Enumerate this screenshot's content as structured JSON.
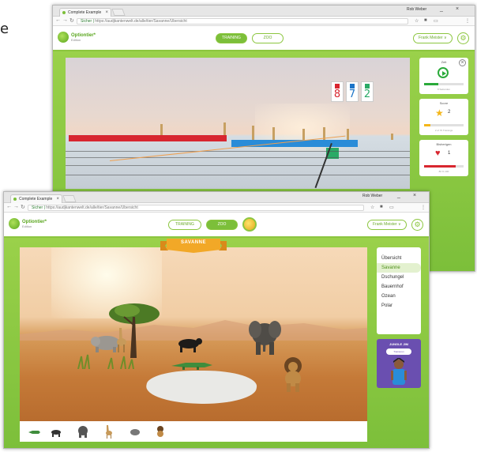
{
  "edge_label": "e",
  "browser": {
    "tab_title": "Complete Example",
    "user": "Rob Weber",
    "url_secure": "Sicher",
    "url_rest": "https://audjkantenwelt.de/alle/tier/Savanne/Ubersicht",
    "controls": [
      "_",
      "□",
      "×"
    ]
  },
  "app": {
    "logo_text": "Optiontier*",
    "logo_sub": "Edition",
    "nav": [
      "TRAINING",
      "ZOO"
    ],
    "user_pill": "Frank Meister ∨"
  },
  "window1": {
    "score": [
      {
        "digit": "8",
        "color": "#d8262f"
      },
      {
        "digit": "7",
        "color": "#1c75c8"
      },
      {
        "digit": "2",
        "color": "#2aaa66"
      }
    ],
    "stats": [
      {
        "title": "Zeit",
        "icon": "play-icon",
        "sub": "8 Sekunden",
        "fill": 0.35,
        "color": "#2aaa3a"
      },
      {
        "title": "Score",
        "icon": "star-icon",
        "value": "2",
        "sub": "2 of 70 Trainings",
        "fill": 0.15,
        "color": "#f4b61a"
      },
      {
        "title": "Bisherigen",
        "icon": "heart-icon",
        "value": "1",
        "sub": "80 % 100",
        "fill": 0.8,
        "color": "#d8262f"
      }
    ]
  },
  "window2": {
    "banner": "SAVANNE",
    "menu": [
      "Übersicht",
      "Savanne",
      "Dschungel",
      "Bauernhof",
      "Ozean",
      "Polar"
    ],
    "menu_active": 1,
    "promo_title": "JUNGLE JIM",
    "promo_button": "Trainieren",
    "animals": [
      "crocodile-icon",
      "buffalo-icon",
      "elephant-icon",
      "giraffe-icon",
      "rhino-icon",
      "lion-icon"
    ]
  }
}
